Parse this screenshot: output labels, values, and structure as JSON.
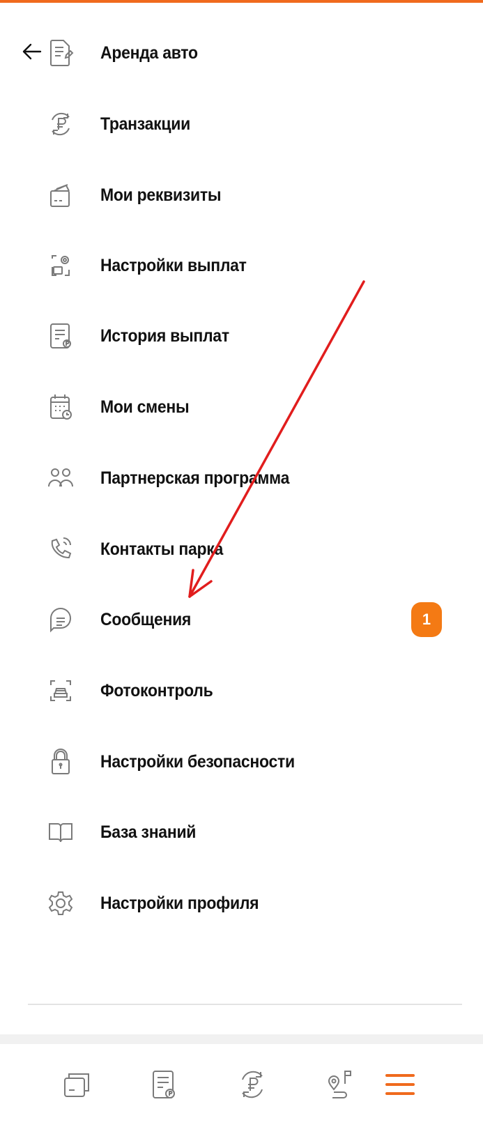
{
  "menu": {
    "items": [
      {
        "label": "Аренда авто",
        "icon": "car-rental-document-icon"
      },
      {
        "label": "Транзакции",
        "icon": "ruble-exchange-icon"
      },
      {
        "label": "Мои реквизиты",
        "icon": "wallet-cards-icon"
      },
      {
        "label": "Настройки выплат",
        "icon": "payout-settings-icon"
      },
      {
        "label": "История выплат",
        "icon": "payout-history-icon"
      },
      {
        "label": "Мои смены",
        "icon": "calendar-clock-icon"
      },
      {
        "label": "Партнерская программа",
        "icon": "partners-icon"
      },
      {
        "label": "Контакты парка",
        "icon": "phone-icon"
      },
      {
        "label": "Сообщения",
        "icon": "chat-bubble-icon",
        "badge": "1"
      },
      {
        "label": "Фотоконтроль",
        "icon": "photo-control-car-icon"
      },
      {
        "label": "Настройки безопасности",
        "icon": "padlock-icon"
      },
      {
        "label": "База знаний",
        "icon": "open-book-icon"
      },
      {
        "label": "Настройки профиля",
        "icon": "gear-icon"
      }
    ]
  },
  "bottom_nav": {
    "items": [
      {
        "icon": "cards-icon"
      },
      {
        "icon": "payout-history-icon"
      },
      {
        "icon": "ruble-exchange-icon"
      },
      {
        "icon": "route-map-icon"
      },
      {
        "icon": "hamburger-menu-icon",
        "active": true
      }
    ]
  },
  "colors": {
    "accent": "#f06a1d",
    "badge": "#f47a14",
    "annotation_arrow": "#e11d1d",
    "icon": "#7a7a7a"
  }
}
